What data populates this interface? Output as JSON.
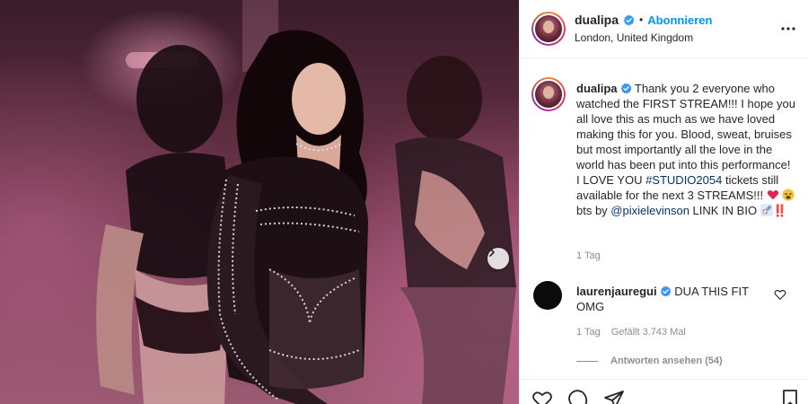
{
  "post": {
    "username": "dualipa",
    "follow_label": "Abonnieren",
    "separator": "•",
    "location": "London, United Kingdom"
  },
  "caption": {
    "username": "dualipa",
    "text_1": "Thank you 2 everyone who watched the FIRST STREAM!!! I hope you all love this as much as we have loved making this for you. Blood, sweat, bruises but most importantly all the love in the world has been put into this performance! I LOVE YOU ",
    "hashtag": "#STUDIO2054",
    "text_2": " tickets still available for the next 3 STREAMS!!! ",
    "emoji_1": "heart-emoji",
    "emoji_2": "tired-face-emoji",
    "text_3": " bts by ",
    "mention": "@pixielevinson",
    "text_4": " LINK IN BIO ",
    "emoji_3": "rocket-emoji",
    "text_5": "‼️",
    "time": "1 Tag"
  },
  "comment": {
    "username": "laurenjauregui",
    "text": "DUA THIS FIT OMG",
    "time": "1 Tag",
    "likes": "Gefällt 3.743 Mal",
    "replies": "Antworten ansehen (54)"
  },
  "colors": {
    "accent": "#0095f6",
    "verified": "#3897f0",
    "link": "#00376b",
    "muted": "#8e8e8e"
  },
  "icons": [
    "more-options-icon",
    "verified-badge-icon",
    "next-arrow-icon",
    "heart-icon",
    "comment-icon",
    "share-icon",
    "save-icon"
  ]
}
